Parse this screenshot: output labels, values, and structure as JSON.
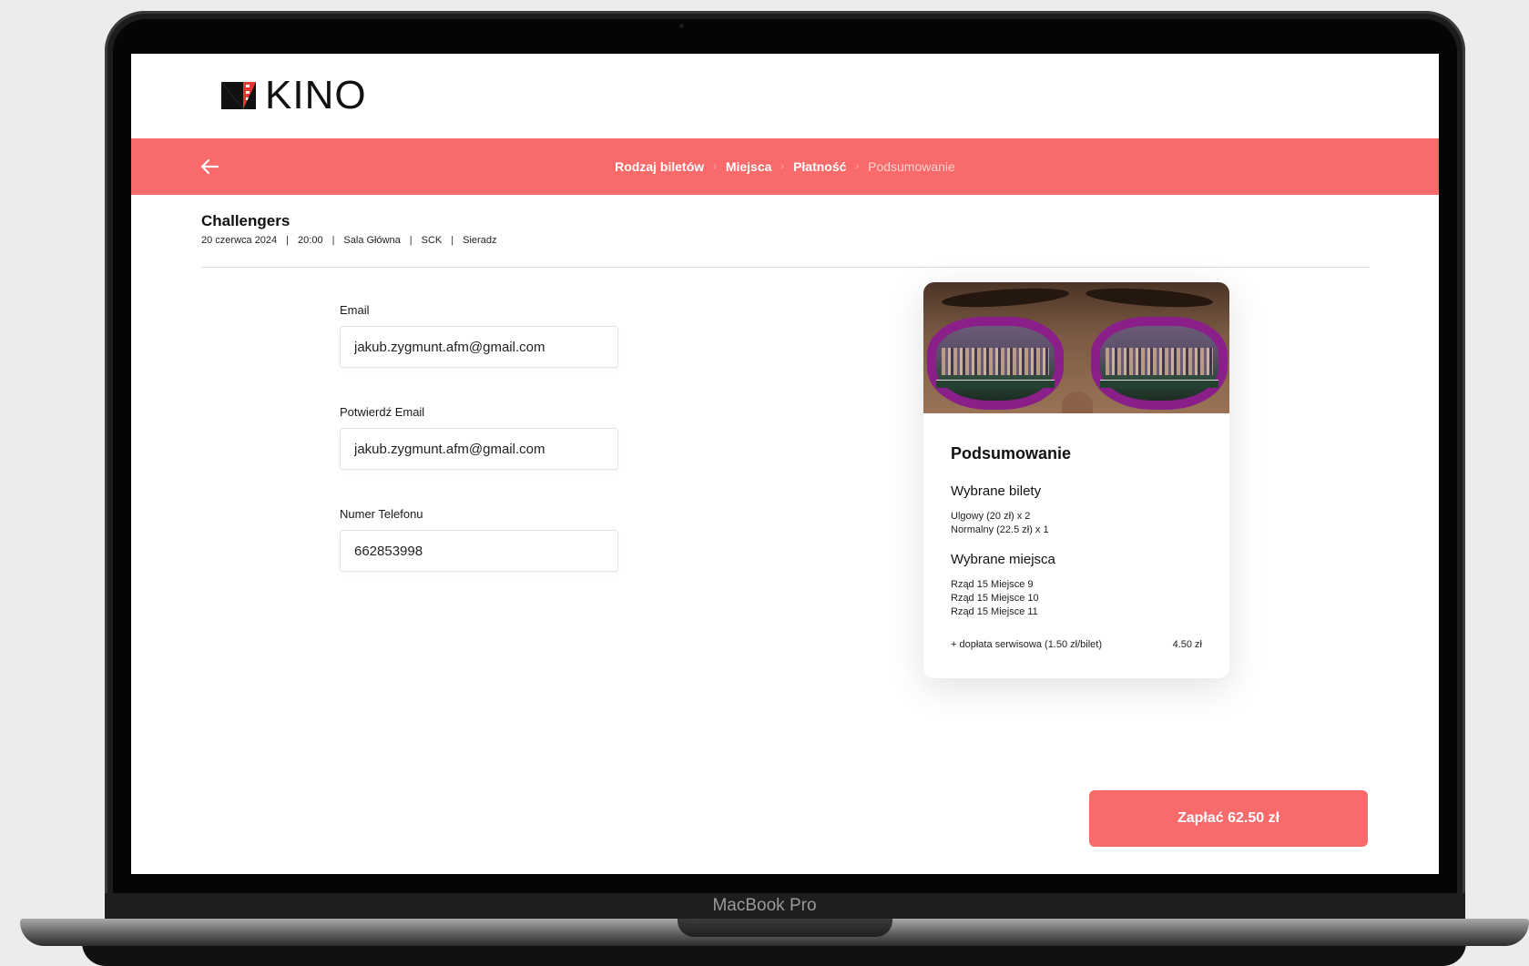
{
  "device": {
    "label": "MacBook Pro"
  },
  "header": {
    "logo_text": "KINO"
  },
  "steps": [
    {
      "label": "Rodzaj biletów",
      "active": true
    },
    {
      "label": "Miejsca",
      "active": true
    },
    {
      "label": "Płatność",
      "active": true
    },
    {
      "label": "Podsumowanie",
      "active": false
    }
  ],
  "movie": {
    "title": "Challengers",
    "date": "20 czerwca 2024",
    "time": "20:00",
    "hall": "Sala Główna",
    "venue": "SCK",
    "city": "Sieradz"
  },
  "form": {
    "email_label": "Email",
    "email_value": "jakub.zygmunt.afm@gmail.com",
    "confirm_label": "Potwierdź Email",
    "confirm_value": "jakub.zygmunt.afm@gmail.com",
    "phone_label": "Numer Telefonu",
    "phone_value": "662853998"
  },
  "summary": {
    "title": "Podsumowanie",
    "tickets_heading": "Wybrane bilety",
    "tickets": [
      "Ulgowy (20 zł) x 2",
      "Normalny (22.5 zł) x 1"
    ],
    "seats_heading": "Wybrane miejsca",
    "seats": [
      "Rząd 15 Miejsce 9",
      "Rząd 15 Miejsce 10",
      "Rząd 15 Miejsce 11"
    ],
    "fee_label": "+ dopłata serwisowa (1.50 zł/bilet)",
    "fee_value": "4.50 zł"
  },
  "pay_button": {
    "label": "Zapłać 62.50 zł"
  },
  "colors": {
    "accent": "#f96a6a",
    "lens_frame": "#8a1f8a"
  }
}
